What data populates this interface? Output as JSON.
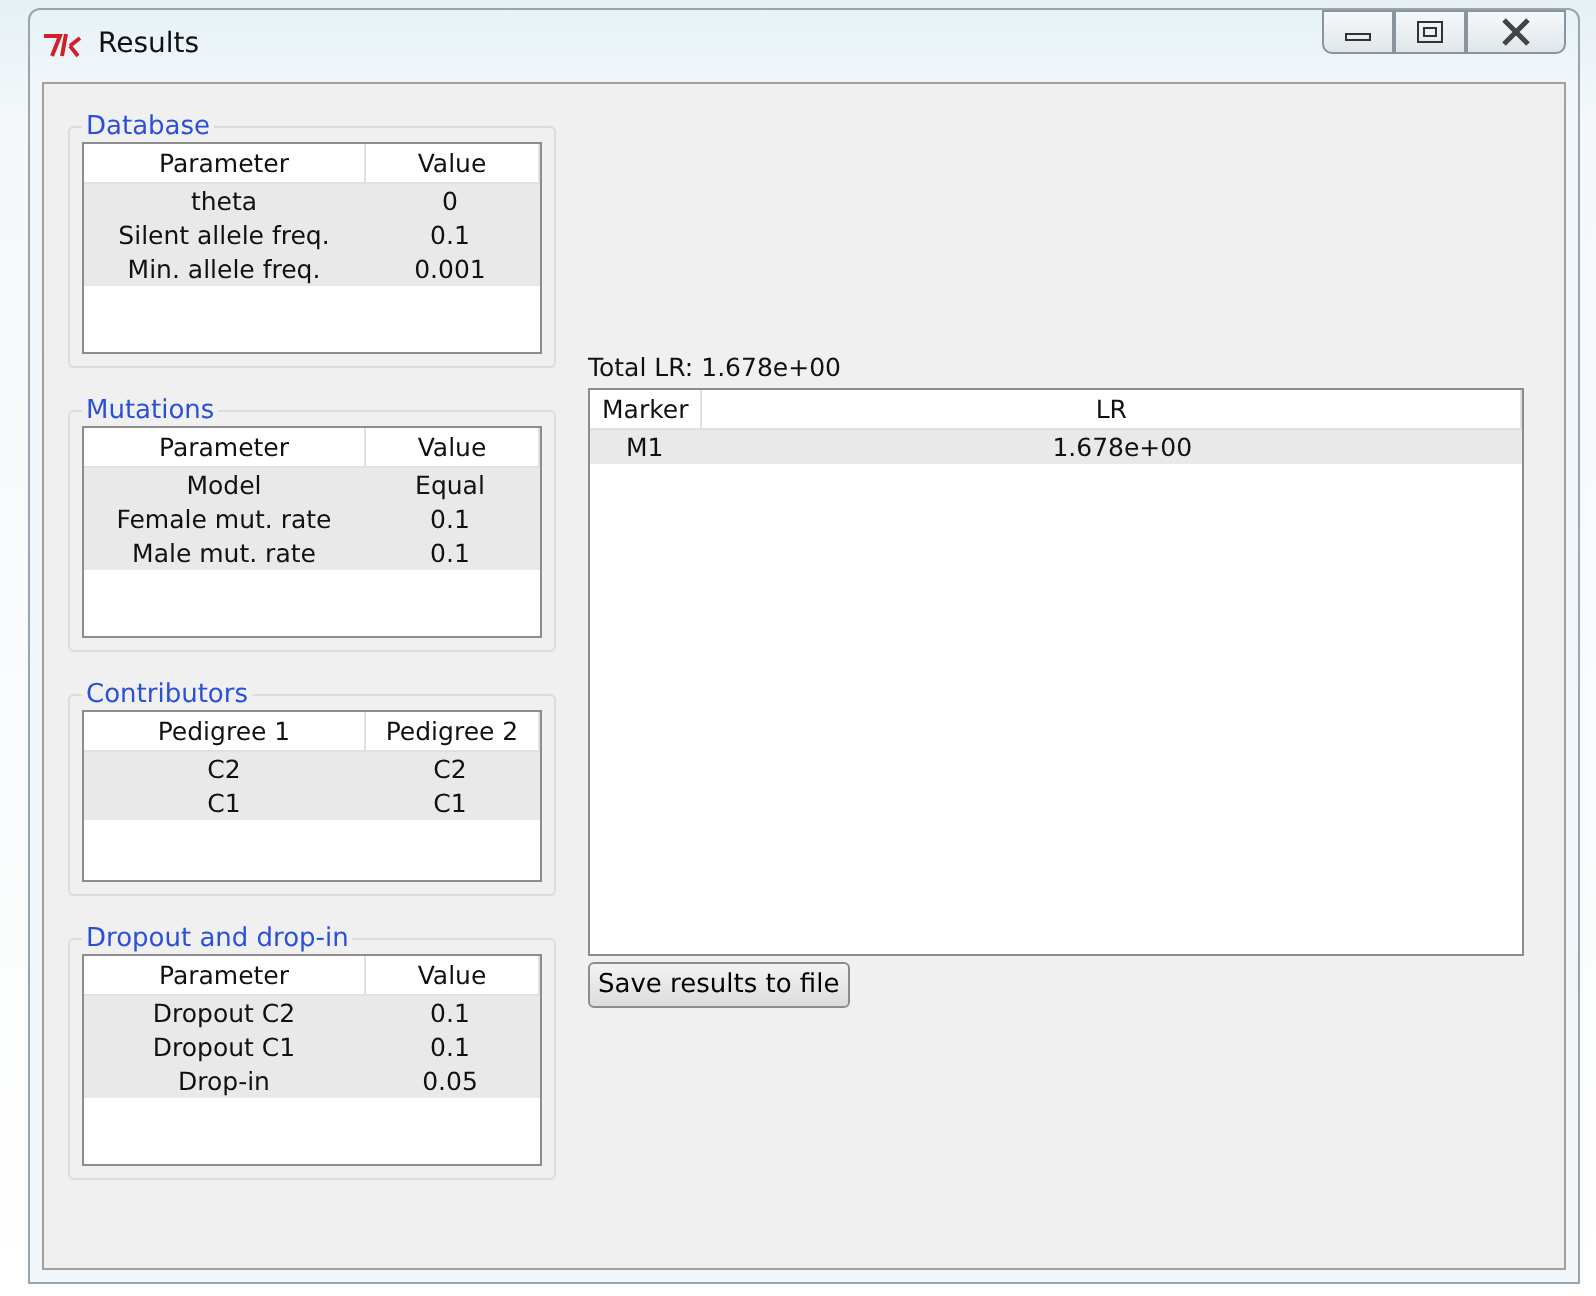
{
  "window": {
    "title": "Results"
  },
  "groups": [
    {
      "title": "Database",
      "columns": [
        "Parameter",
        "Value"
      ],
      "rows": [
        [
          "theta",
          "0"
        ],
        [
          "Silent allele freq.",
          "0.1"
        ],
        [
          "Min. allele freq.",
          "0.001"
        ]
      ]
    },
    {
      "title": "Mutations",
      "columns": [
        "Parameter",
        "Value"
      ],
      "rows": [
        [
          "Model",
          "Equal"
        ],
        [
          "Female mut. rate",
          "0.1"
        ],
        [
          "Male mut. rate",
          "0.1"
        ]
      ]
    },
    {
      "title": "Contributors",
      "columns": [
        "Pedigree 1",
        "Pedigree 2"
      ],
      "rows": [
        [
          "C2",
          "C2"
        ],
        [
          "C1",
          "C1"
        ]
      ]
    },
    {
      "title": "Dropout and drop-in",
      "columns": [
        "Parameter",
        "Value"
      ],
      "rows": [
        [
          "Dropout C2",
          "0.1"
        ],
        [
          "Dropout C1",
          "0.1"
        ],
        [
          "Drop-in",
          "0.05"
        ]
      ]
    }
  ],
  "total_lr": "Total LR: 1.678e+00",
  "results": {
    "columns": [
      "Marker",
      "LR"
    ],
    "rows": [
      [
        "M1",
        "1.678e+00"
      ]
    ]
  },
  "save_button": "Save results to file"
}
